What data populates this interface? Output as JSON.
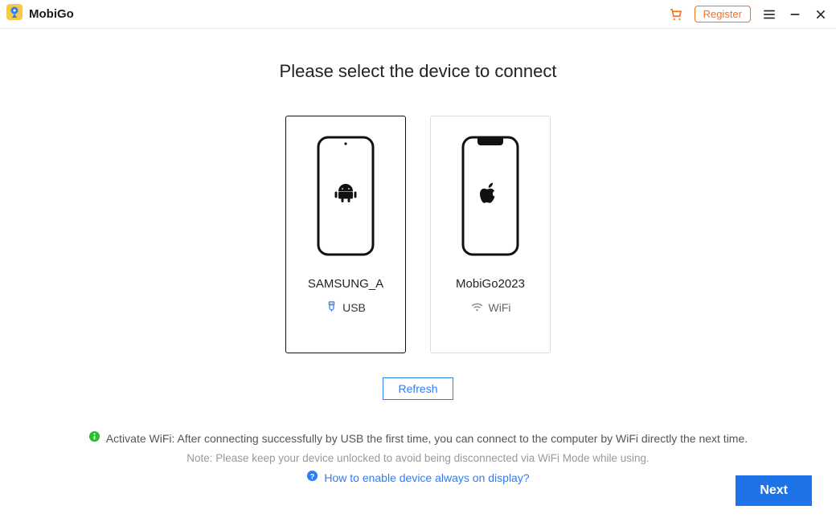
{
  "app_title": "MobiGo",
  "header": {
    "register_label": "Register"
  },
  "heading": "Please select the device to connect",
  "devices": [
    {
      "name": "SAMSUNG_A",
      "connection_type": "USB",
      "platform": "android",
      "selected": true
    },
    {
      "name": "MobiGo2023",
      "connection_type": "WiFi",
      "platform": "ios",
      "selected": false
    }
  ],
  "refresh_label": "Refresh",
  "hint_wifi": "Activate WiFi: After connecting successfully by USB the first time, you can connect to the computer by WiFi directly the next time.",
  "hint_note": "Note: Please keep your device unlocked to avoid being disconnected via WiFi Mode while using.",
  "help_link": "How to enable device always on display?",
  "next_label": "Next"
}
